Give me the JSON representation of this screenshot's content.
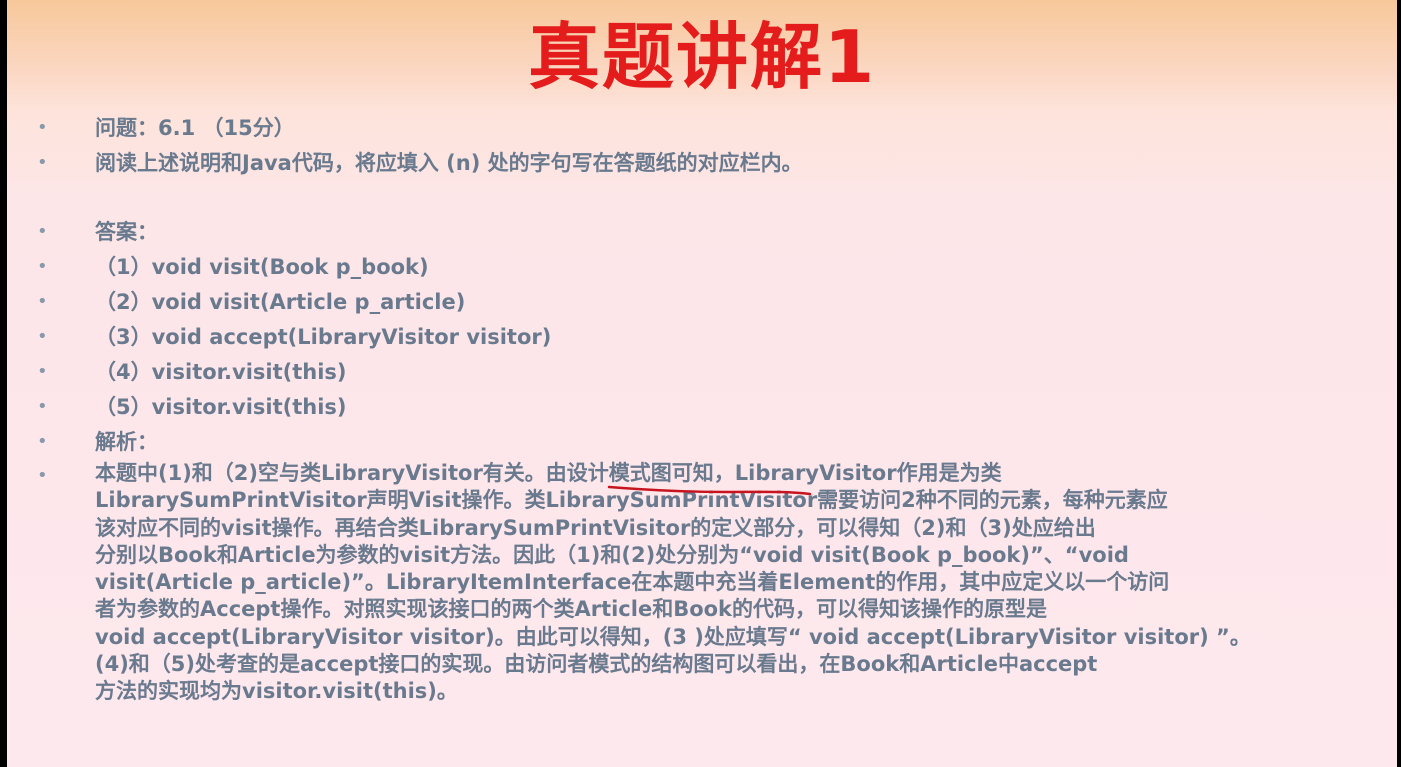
{
  "title": "真题讲解1",
  "bullet_char": "•",
  "items": [
    {
      "id": "question",
      "text": "问题：6.1   （15分）"
    },
    {
      "id": "instruction",
      "text": "  阅读上述说明和Java代码，将应填入 (n) 处的字句写在答题纸的对应栏内。"
    },
    {
      "id": "answer_heading",
      "text": "答案："
    },
    {
      "id": "a1",
      "text": "（1）void visit(Book p_book)"
    },
    {
      "id": "a2",
      "text": "（2）void visit(Article p_article)"
    },
    {
      "id": "a3",
      "text": "（3）void accept(LibraryVisitor visitor)"
    },
    {
      "id": "a4",
      "text": "（4）visitor.visit(this)"
    },
    {
      "id": "a5",
      "text": "（5）visitor.visit(this)"
    },
    {
      "id": "analysis_heading",
      "text": "解析："
    }
  ],
  "analysis_lines": [
    "本题中(1)和（2)空与类LibraryVisitor有关。由设计模式图可知，LibraryVisitor作用是为类",
    "LibrarySumPrintVisitor声明Visit操作。类LibrarySumPrintVisitor需要访问2种不同的元素，每种元素应",
    "该对应不同的visit操作。再结合类LibrarySumPrintVisitor的定义部分，可以得知（2)和（3)处应给出",
    "分别以Book和Article为参数的visit方法。因此（1)和(2)处分别为“void visit(Book p_book)”、“void",
    "visit(Article p_article)”。LibraryItemInterface在本题中充当着Element的作用，其中应定义以一个访问",
    "者为参数的Accept操作。对照实现该接口的两个类Article和Book的代码，可以得知该操作的原型是",
    "void accept(LibraryVisitor visitor)。由此可以得知，(3 )处应填写“ void accept(LibraryVisitor visitor) ”。",
    "(4)和（5)处考查的是accept接口的实现。由访问者模式的结构图可以看出，在Book和Article中accept",
    "方法的实现均为visitor.visit(this)。"
  ],
  "colors": {
    "title": "#e41c1c",
    "text": "#6a7a8e",
    "annotation": "#c8141e"
  }
}
